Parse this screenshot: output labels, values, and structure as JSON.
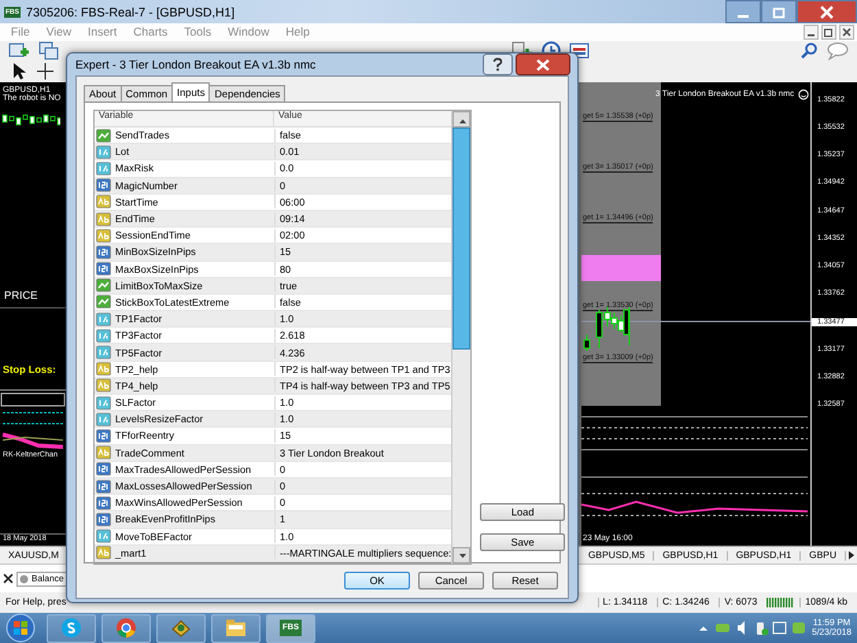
{
  "app_window": {
    "icon_label": "FBS",
    "title": "7305206: FBS-Real-7 - [GBPUSD,H1]"
  },
  "menu": [
    "File",
    "View",
    "Insert",
    "Charts",
    "Tools",
    "Window",
    "Help"
  ],
  "left_chart": {
    "symbol": "GBPUSD,H1",
    "notice": "The robot is NO",
    "price_label": "PRICE",
    "stop_loss_label": "Stop Loss:",
    "indicator_label": "RK-KeltnerChan",
    "date_label": "18 May 2018"
  },
  "right_chart": {
    "ea_label": "3 Tier London Breakout EA  v1.3b nmc",
    "levels": [
      "get 5= 1.35538  (+0p)",
      "get 3= 1.35017  (+0p)",
      "get 1= 1.34496  (+0p)",
      "get 1= 1.33530  (+0p)",
      "get 3= 1.33009  (+0p)"
    ],
    "price_axis": [
      {
        "label": "1.35822",
        "selected": false
      },
      {
        "label": "1.35532",
        "selected": false
      },
      {
        "label": "1.35237",
        "selected": false
      },
      {
        "label": "1.34942",
        "selected": false
      },
      {
        "label": "1.34647",
        "selected": false
      },
      {
        "label": "1.34352",
        "selected": false
      },
      {
        "label": "1.34057",
        "selected": false
      },
      {
        "label": "1.33762",
        "selected": false
      },
      {
        "label": "1.33477",
        "selected": true
      },
      {
        "label": "1.33177",
        "selected": false
      },
      {
        "label": "1.32882",
        "selected": false
      },
      {
        "label": "1.32587",
        "selected": false
      }
    ],
    "date_label": "23 May 16:00"
  },
  "chart_tabs_left": [
    {
      "label": "XAUUSD,M",
      "selected": false
    }
  ],
  "chart_tabs_right": [
    {
      "label": "GBPUSD,M5",
      "selected": false
    },
    {
      "label": "GBPUSD,H1",
      "selected": false
    },
    {
      "label": "GBPUSD,H1",
      "selected": false
    },
    {
      "label": "GBPU",
      "selected": false
    }
  ],
  "terminal": {
    "tab": "Balance"
  },
  "status_bar": {
    "help": "For Help, pres",
    "fields": [
      "L: 1.34118",
      "C: 1.34246",
      "V: 6073"
    ],
    "traffic": "1089/4 kb"
  },
  "dialog": {
    "title": "Expert - 3 Tier London Breakout EA v1.3b nmc",
    "tabs": [
      {
        "label": "About",
        "selected": false
      },
      {
        "label": "Common",
        "selected": false
      },
      {
        "label": "Inputs",
        "selected": true
      },
      {
        "label": "Dependencies",
        "selected": false
      }
    ],
    "columns": [
      "Variable",
      "Value"
    ],
    "rows": [
      {
        "kind": "bool",
        "name": "SendTrades",
        "value": "false"
      },
      {
        "kind": "double",
        "name": "Lot",
        "value": "0.01"
      },
      {
        "kind": "double",
        "name": "MaxRisk",
        "value": "0.0"
      },
      {
        "kind": "int",
        "name": "MagicNumber",
        "value": "0"
      },
      {
        "kind": "string",
        "name": "StartTime",
        "value": "06:00"
      },
      {
        "kind": "string",
        "name": "EndTime",
        "value": "09:14"
      },
      {
        "kind": "string",
        "name": "SessionEndTime",
        "value": "02:00"
      },
      {
        "kind": "int",
        "name": "MinBoxSizeInPips",
        "value": "15"
      },
      {
        "kind": "int",
        "name": "MaxBoxSizeInPips",
        "value": "80"
      },
      {
        "kind": "bool",
        "name": "LimitBoxToMaxSize",
        "value": "true"
      },
      {
        "kind": "bool",
        "name": "StickBoxToLatestExtreme",
        "value": "false"
      },
      {
        "kind": "double",
        "name": "TP1Factor",
        "value": "1.0"
      },
      {
        "kind": "double",
        "name": "TP3Factor",
        "value": "2.618"
      },
      {
        "kind": "double",
        "name": "TP5Factor",
        "value": "4.236"
      },
      {
        "kind": "string",
        "name": "TP2_help",
        "value": "TP2 is half-way between TP1 and TP3"
      },
      {
        "kind": "string",
        "name": "TP4_help",
        "value": "TP4 is half-way between TP3 and TP5"
      },
      {
        "kind": "double",
        "name": "SLFactor",
        "value": "1.0"
      },
      {
        "kind": "double",
        "name": "LevelsResizeFactor",
        "value": "1.0"
      },
      {
        "kind": "int",
        "name": "TFforReentry",
        "value": "15"
      },
      {
        "kind": "string",
        "name": "TradeComment",
        "value": "3 Tier London Breakout"
      },
      {
        "kind": "int",
        "name": "MaxTradesAllowedPerSession",
        "value": "0"
      },
      {
        "kind": "int",
        "name": "MaxLossesAllowedPerSession",
        "value": "0"
      },
      {
        "kind": "int",
        "name": "MaxWinsAllowedPerSession",
        "value": "0"
      },
      {
        "kind": "int",
        "name": "BreakEvenProfitInPips",
        "value": "1"
      },
      {
        "kind": "double",
        "name": "MoveToBEFactor",
        "value": "1.0"
      },
      {
        "kind": "string",
        "name": "_mart1",
        "value": "---MARTINGALE multipliers sequence:"
      }
    ],
    "side_buttons": [
      "Load",
      "Save"
    ],
    "buttons": [
      "OK",
      "Cancel",
      "Reset"
    ]
  },
  "taskbar": {
    "apps": [
      {
        "kind": "skype"
      },
      {
        "kind": "chrome"
      },
      {
        "kind": "app"
      },
      {
        "kind": "folder"
      },
      {
        "kind": "fbs",
        "label": "FBS"
      }
    ],
    "time": "11:59 PM",
    "date": "5/23/2018"
  }
}
